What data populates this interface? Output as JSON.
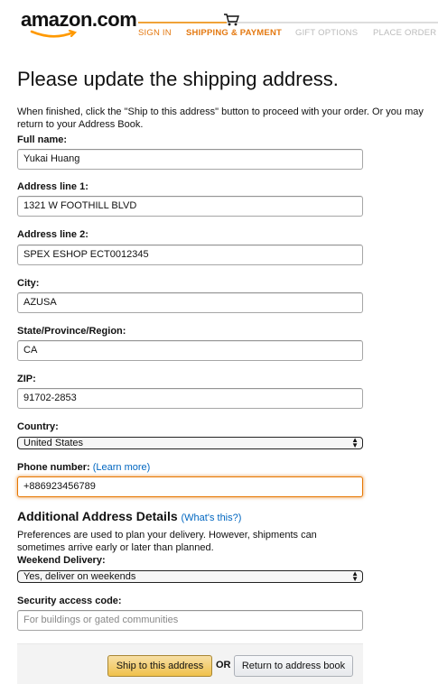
{
  "header": {
    "logo_text": "amazon.com",
    "steps": [
      "SIGN IN",
      "SHIPPING & PAYMENT",
      "GIFT OPTIONS",
      "PLACE ORDER"
    ],
    "accent_color": "#e47911"
  },
  "page": {
    "title": "Please update the shipping address.",
    "intro": "When finished, click the \"Ship to this address\" button to proceed with your order. Or you may return to your Address Book."
  },
  "form": {
    "full_name": {
      "label": "Full name:",
      "value": "Yukai Huang"
    },
    "address1": {
      "label": "Address line 1:",
      "value": "1321 W FOOTHILL BLVD"
    },
    "address2": {
      "label": "Address line 2:",
      "value": "SPEX ESHOP ECT0012345"
    },
    "city": {
      "label": "City:",
      "value": "AZUSA"
    },
    "state": {
      "label": "State/Province/Region:",
      "value": "CA"
    },
    "zip": {
      "label": "ZIP:",
      "value": "91702-2853"
    },
    "country": {
      "label": "Country:",
      "value": "United States"
    },
    "phone": {
      "label": "Phone number:",
      "link": "(Learn more)",
      "value": "+886923456789"
    }
  },
  "additional": {
    "title": "Additional Address Details",
    "link": "(What's this?)",
    "description": "Preferences are used to plan your delivery. However, shipments can sometimes arrive early or later than planned.",
    "weekend": {
      "label": "Weekend Delivery:",
      "value": "Yes, deliver on weekends"
    },
    "security": {
      "label": "Security access code:",
      "placeholder": "For buildings or gated communities"
    }
  },
  "actions": {
    "ship": "Ship to this address",
    "or": "OR",
    "return": "Return to address book"
  }
}
